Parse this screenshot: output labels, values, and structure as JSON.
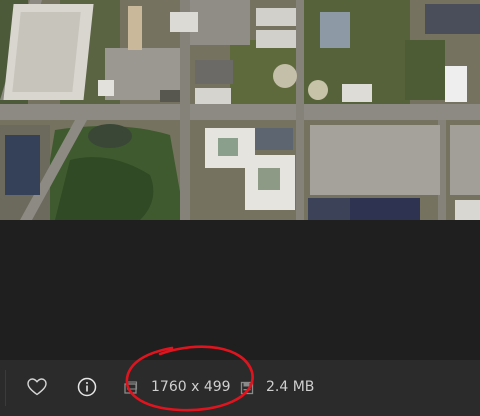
{
  "photo": {
    "description_icon": "aerial-map-image"
  },
  "info_bar": {
    "favorite_icon": "heart-icon",
    "info_icon": "info-icon",
    "dimensions_icon": "image-dimensions-icon",
    "dimensions": "1760 x 499",
    "filesize_icon": "file-size-icon",
    "file_size": "2.4 MB"
  },
  "colors": {
    "background": "#1f1f1f",
    "bar": "#2b2b2b",
    "text": "#cfcfcf",
    "annotation": "#e0141e"
  }
}
